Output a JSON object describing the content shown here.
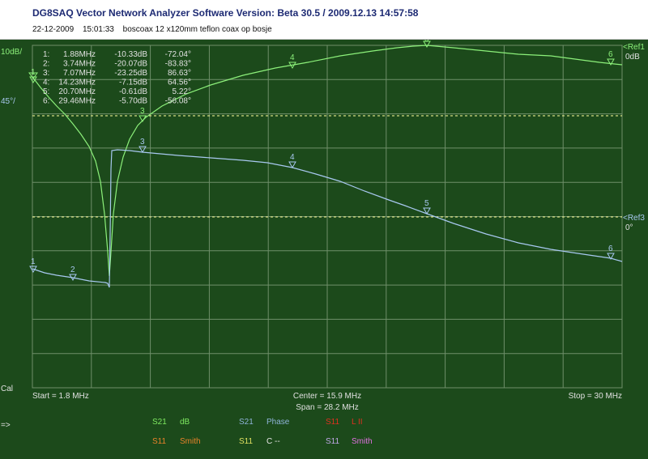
{
  "header": {
    "title": "DG8SAQ Vector Network Analyzer Software   Version:  Beta 30.5 / 2009.12.13 14:57:58",
    "date": "22-12-2009",
    "time": "15:01:33",
    "description": "boscoax 12 x120mm teflon coax op bosje"
  },
  "scale": {
    "left_top": "10dB/",
    "left_second": "45°/",
    "ref1_name": "<Ref1",
    "ref1_value": "0dB",
    "ref3_name": "<Ref3",
    "ref3_value": "0°",
    "cal_label": "Cal"
  },
  "frequency": {
    "start": "Start = 1.8 MHz",
    "center": "Center = 15.9 MHz",
    "span": "Span = 28.2 MHz",
    "stop": "Stop = 30 MHz"
  },
  "markers": [
    {
      "num": "1:",
      "freq": "1.88MHz",
      "db": "-10.33dB",
      "phase": "-72.04°"
    },
    {
      "num": "2:",
      "freq": "3.74MHz",
      "db": "-20.07dB",
      "phase": "-83.83°"
    },
    {
      "num": "3:",
      "freq": "7.07MHz",
      "db": "-23.25dB",
      "phase": "86.63°"
    },
    {
      "num": "4:",
      "freq": "14.23MHz",
      "db": "-7.15dB",
      "phase": "64.56°"
    },
    {
      "num": "5:",
      "freq": "20.70MHz",
      "db": "-0.61dB",
      "phase": "5.22°"
    },
    {
      "num": "6:",
      "freq": "29.46MHz",
      "db": "-5.70dB",
      "phase": "-56.08°"
    }
  ],
  "legend": {
    "arrow": "=>",
    "row1": [
      {
        "param": "S21",
        "mode": "dB",
        "param_color": "#7ee860",
        "mode_color": "#7ee860"
      },
      {
        "param": "S21",
        "mode": "Phase",
        "param_color": "#8fb4d9",
        "mode_color": "#8fb4d9"
      },
      {
        "param": "S11",
        "mode": "L II",
        "param_color": "#e03020",
        "mode_color": "#e03020"
      }
    ],
    "row2": [
      {
        "param": "S11",
        "mode": "Smith",
        "param_color": "#e8822a",
        "mode_color": "#e8822a"
      },
      {
        "param": "S11",
        "mode": "C --",
        "param_color": "#e0e060",
        "mode_color": "#e8e8e8"
      },
      {
        "param": "S11",
        "mode": "Smith",
        "param_color": "#c0a8e8",
        "mode_color": "#e070e0"
      }
    ]
  },
  "colors": {
    "background": "#1c4a1b",
    "grid": "#6f8f6a",
    "db_trace": "#8cf07a",
    "phase_trace": "#a8c8f0",
    "label_text": "#e0e0e0",
    "ref_line": "#ffff9a"
  }
}
